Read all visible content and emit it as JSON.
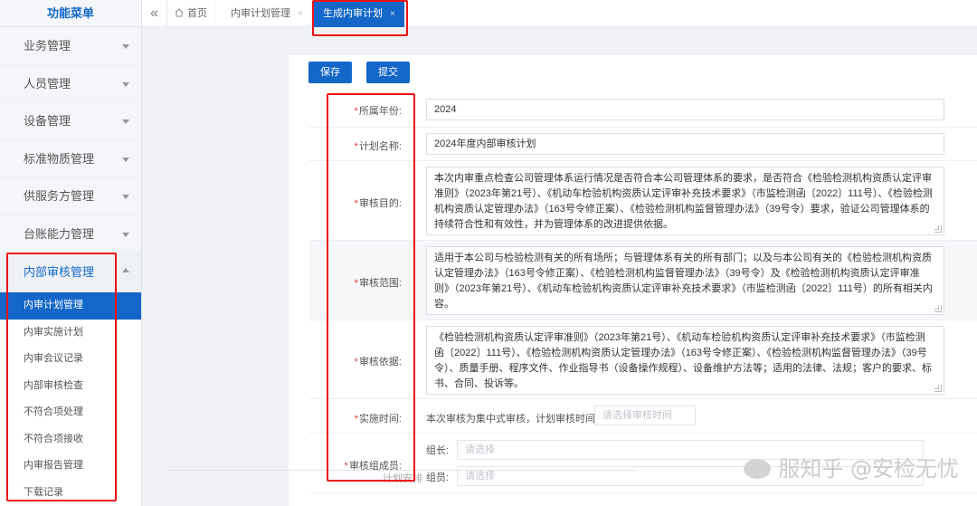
{
  "sidebar": {
    "title": "功能菜单",
    "items": [
      {
        "label": "业务管理"
      },
      {
        "label": "人员管理"
      },
      {
        "label": "设备管理"
      },
      {
        "label": "标准物质管理"
      },
      {
        "label": "供服务方管理"
      },
      {
        "label": "台账能力管理"
      },
      {
        "label": "内部审核管理"
      }
    ],
    "subitems": [
      {
        "label": "内审计划管理"
      },
      {
        "label": "内审实施计划"
      },
      {
        "label": "内审会议记录"
      },
      {
        "label": "内部审核检查"
      },
      {
        "label": "不符合项处理"
      },
      {
        "label": "不符合项接收"
      },
      {
        "label": "内审报告管理"
      },
      {
        "label": "下载记录"
      }
    ]
  },
  "tabs": {
    "collapse_glyph": "«",
    "home": "首页",
    "plan_mgmt": "内审计划管理",
    "generate": "生成内审计划",
    "close_glyph": "×"
  },
  "toolbar": {
    "save": "保存",
    "submit": "提交"
  },
  "form": {
    "year": {
      "label": "所属年份:",
      "value": "2024"
    },
    "plan_name": {
      "label": "计划名称:",
      "value": "2024年度内部审核计划"
    },
    "purpose": {
      "label": "审核目的:",
      "value": "本次内审重点检查公司管理体系运行情况是否符合本公司管理体系的要求，是否符合《检验检测机构资质认定评审准则》（2023年第21号）、《机动车检验机构资质认定评审补充技术要求》（市监检测函〔2022〕111号）、《检验检测机构资质认定管理办法》（163号令修正案）、《检验检测机构监督管理办法》（39号令）要求，验证公司管理体系的持续符合性和有效性，并为管理体系的改进提供依据。"
    },
    "scope": {
      "label": "审核范围:",
      "value": "适用于本公司与检验检测有关的所有场所；与管理体系有关的所有部门；以及与本公司有关的《检验检测机构资质认定管理办法》（163号令修正案）、《检验检测机构监督管理办法》（39号令）及《检验检测机构资质认定评审准则》（2023年第21号）、《机动车检验机构资质认定评审补充技术要求》（市监检测函〔2022〕111号）的所有相关内容。"
    },
    "basis": {
      "label": "审核依据:",
      "value": "《检验检测机构资质认定评审准则》（2023年第21号）、《机动车检验机构资质认定评审补充技术要求》（市监检测函〔2022〕111号）、《检验检测机构资质认定管理办法》（163号令修正案）、《检验检测机构监督管理办法》（39号令）、质量手册、程序文件、作业指导书（设备操作规程）、设备维护方法等；适用的法律、法规；客户的要求、标书、合同、投诉等。"
    },
    "time": {
      "label": "实施时间:",
      "text": "本次审核为集中式审核，计划审核时间为",
      "placeholder": "请选择审核时间"
    },
    "members": {
      "label": "审核组成员:",
      "leader_label": "组长:",
      "member_label": "组员:",
      "placeholder": "请选择"
    }
  },
  "bottom_label": "计划安排",
  "watermark": "服知乎 @安检无忧"
}
